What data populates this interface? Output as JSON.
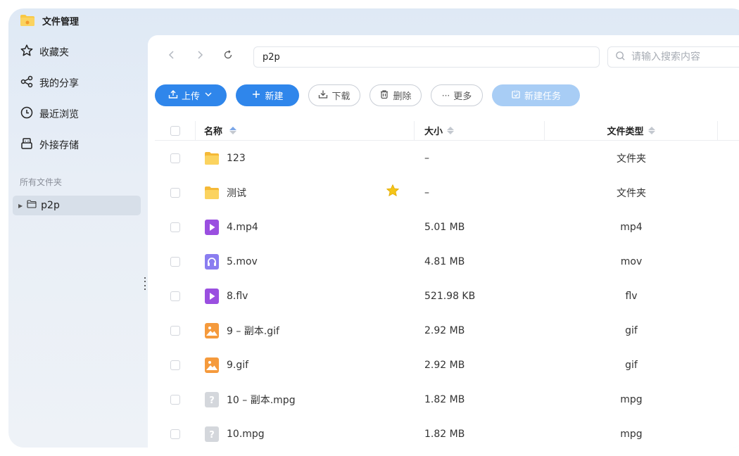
{
  "app": {
    "title": "文件管理"
  },
  "sidebar": {
    "items": [
      {
        "label": "收藏夹",
        "icon": "star-icon"
      },
      {
        "label": "我的分享",
        "icon": "share-icon"
      },
      {
        "label": "最近浏览",
        "icon": "clock-icon"
      },
      {
        "label": "外接存储",
        "icon": "external-storage-icon"
      }
    ],
    "section_title": "所有文件夹",
    "tree": [
      {
        "label": "p2p",
        "icon": "folder-outline-icon"
      }
    ]
  },
  "toolbar": {
    "path": "p2p",
    "search_placeholder": "请输入搜索内容",
    "buttons": {
      "upload": "上传",
      "new": "新建",
      "download": "下载",
      "delete": "删除",
      "more": "更多",
      "new_task": "新建任务"
    }
  },
  "table": {
    "columns": {
      "name": "名称",
      "size": "大小",
      "type": "文件类型"
    },
    "rows": [
      {
        "name": "123",
        "size": "–",
        "type": "文件夹",
        "icon": "folder-icon",
        "starred": false
      },
      {
        "name": "测试",
        "size": "–",
        "type": "文件夹",
        "icon": "folder-icon",
        "starred": true
      },
      {
        "name": "4.mp4",
        "size": "5.01 MB",
        "type": "mp4",
        "icon": "video-file-icon",
        "starred": false
      },
      {
        "name": "5.mov",
        "size": "4.81 MB",
        "type": "mov",
        "icon": "audio-file-icon",
        "starred": false
      },
      {
        "name": "8.flv",
        "size": "521.98 KB",
        "type": "flv",
        "icon": "video-file-icon",
        "starred": false
      },
      {
        "name": "9 – 副本.gif",
        "size": "2.92 MB",
        "type": "gif",
        "icon": "image-file-icon",
        "starred": false
      },
      {
        "name": "9.gif",
        "size": "2.92 MB",
        "type": "gif",
        "icon": "image-file-icon",
        "starred": false
      },
      {
        "name": "10 – 副本.mpg",
        "size": "1.82 MB",
        "type": "mpg",
        "icon": "unknown-file-icon",
        "starred": false
      },
      {
        "name": "10.mpg",
        "size": "1.82 MB",
        "type": "mpg",
        "icon": "unknown-file-icon",
        "starred": false
      }
    ]
  },
  "colors": {
    "accent": "#2f86eb",
    "accent_disabled": "#a8cdf5",
    "folder": "#f7c948",
    "video": "#9a4fe0",
    "audio": "#8a7df0",
    "image": "#f59a3c",
    "unknown": "#c9cdd3",
    "star": "#f5c518"
  }
}
